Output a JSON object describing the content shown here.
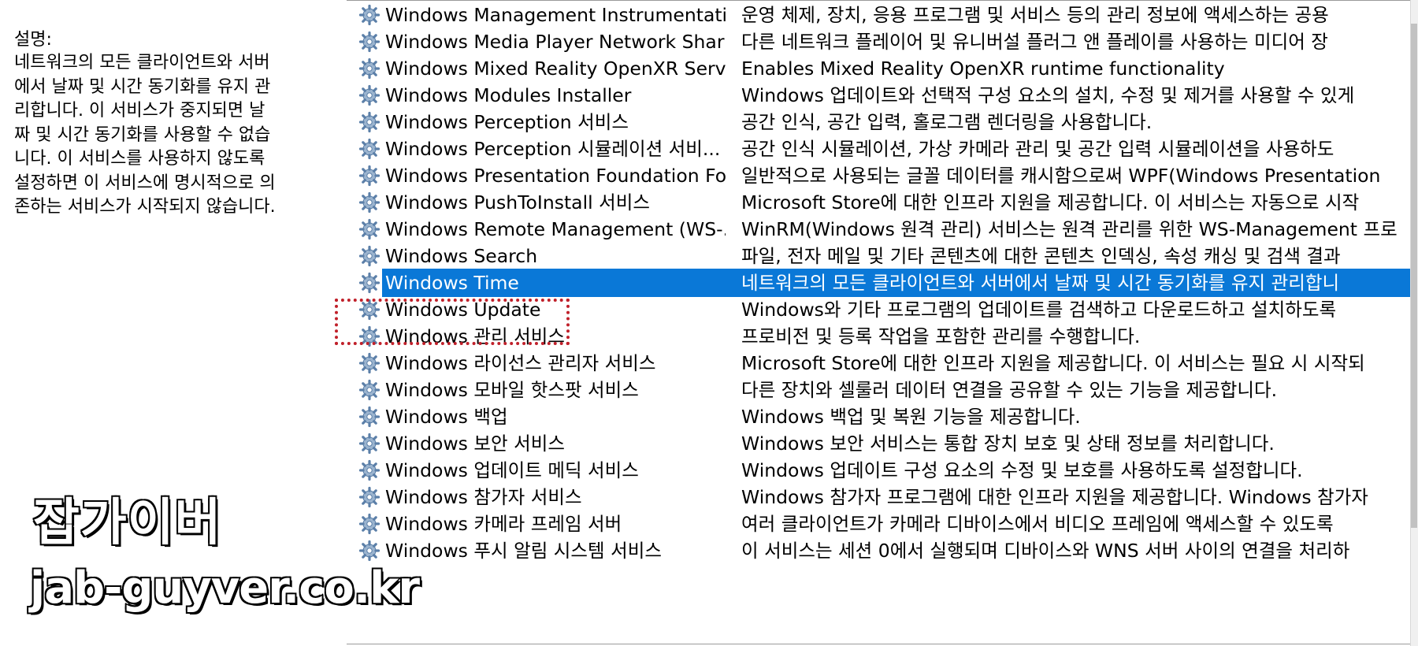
{
  "description_pane": {
    "label": "설명:",
    "text": "네트워크의 모든 클라이언트와 서버\n에서 날짜 및 시간 동기화를 유지 관\n리합니다. 이 서비스가 중지되면 날\n짜 및 시간 동기화를 사용할 수 없습\n니다. 이 서비스를 사용하지 않도록\n설정하면 이 서비스에 명시적으로 의\n존하는 서비스가 시작되지 않습니다."
  },
  "services": [
    {
      "name": "Windows Management Instrumentation",
      "description": "운영 체제, 장치, 응용 프로그램 및 서비스 등의 관리 정보에 액세스하는 공용"
    },
    {
      "name": "Windows Media Player Network Shari...",
      "description": "다른 네트워크 플레이어 및 유니버설 플러그 앤 플레이를 사용하는 미디어 장"
    },
    {
      "name": "Windows Mixed Reality OpenXR Service",
      "description": "Enables Mixed Reality OpenXR runtime functionality"
    },
    {
      "name": "Windows Modules Installer",
      "description": "Windows 업데이트와 선택적 구성 요소의 설치, 수정 및 제거를 사용할 수 있게"
    },
    {
      "name": "Windows Perception 서비스",
      "description": "공간 인식, 공간 입력, 홀로그램 렌더링을 사용합니다."
    },
    {
      "name": "Windows Perception 시뮬레이션 서비...",
      "description": "공간 인식 시뮬레이션, 가상 카메라 관리 및 공간 입력 시뮬레이션을 사용하도"
    },
    {
      "name": "Windows Presentation Foundation Fo...",
      "description": "일반적으로 사용되는 글꼴 데이터를 캐시함으로써 WPF(Windows Presentation"
    },
    {
      "name": "Windows PushToInstall 서비스",
      "description": "Microsoft Store에 대한 인프라 지원을 제공합니다. 이 서비스는 자동으로 시작"
    },
    {
      "name": "Windows Remote Management (WS-...",
      "description": "WinRM(Windows 원격 관리) 서비스는 원격 관리를 위한 WS-Management 프로"
    },
    {
      "name": "Windows Search",
      "description": "파일, 전자 메일 및 기타 콘텐츠에 대한 콘텐츠 인덱싱, 속성 캐싱 및 검색 결과"
    },
    {
      "name": "Windows Time",
      "description": "네트워크의 모든 클라이언트와 서버에서 날짜 및 시간 동기화를 유지 관리합니"
    },
    {
      "name": "Windows Update",
      "description": "Windows와 기타 프로그램의 업데이트를 검색하고 다운로드하고 설치하도록"
    },
    {
      "name": "Windows 관리 서비스",
      "description": "프로비전 및 등록 작업을 포함한 관리를 수행합니다."
    },
    {
      "name": "Windows 라이선스 관리자 서비스",
      "description": "Microsoft Store에 대한 인프라 지원을 제공합니다. 이 서비스는 필요 시 시작되"
    },
    {
      "name": "Windows 모바일 핫스팟 서비스",
      "description": "다른 장치와 셀룰러 데이터 연결을 공유할 수 있는 기능을 제공합니다."
    },
    {
      "name": "Windows 백업",
      "description": "Windows 백업 및 복원 기능을 제공합니다."
    },
    {
      "name": "Windows 보안 서비스",
      "description": "Windows 보안 서비스는 통합 장치 보호 및 상태 정보를 처리합니다."
    },
    {
      "name": "Windows 업데이트 메딕 서비스",
      "description": "Windows 업데이트 구성 요소의 수정 및 보호를 사용하도록 설정합니다."
    },
    {
      "name": "Windows 참가자 서비스",
      "description": "Windows 참가자 프로그램에 대한 인프라 지원을 제공합니다. Windows 참가자"
    },
    {
      "name": "Windows 카메라 프레임 서버",
      "description": "여러 클라이언트가 카메라 디바이스에서 비디오 프레임에 액세스할 수 있도록"
    },
    {
      "name": "Windows 푸시 알림 시스템 서비스",
      "description": "이 서비스는 세션 0에서 실행되며 디바이스와 WNS 서버 사이의 연결을 처리하"
    }
  ],
  "selected_service": "Windows Time",
  "watermark": {
    "title": "잡가이버",
    "url": "jab-guyver.co.kr"
  },
  "colors": {
    "selection": "#0a78d7",
    "highlight_box": "#c0202a",
    "gear_icon": "#5b8fc9"
  },
  "icons": {
    "service": "gear-icon"
  }
}
